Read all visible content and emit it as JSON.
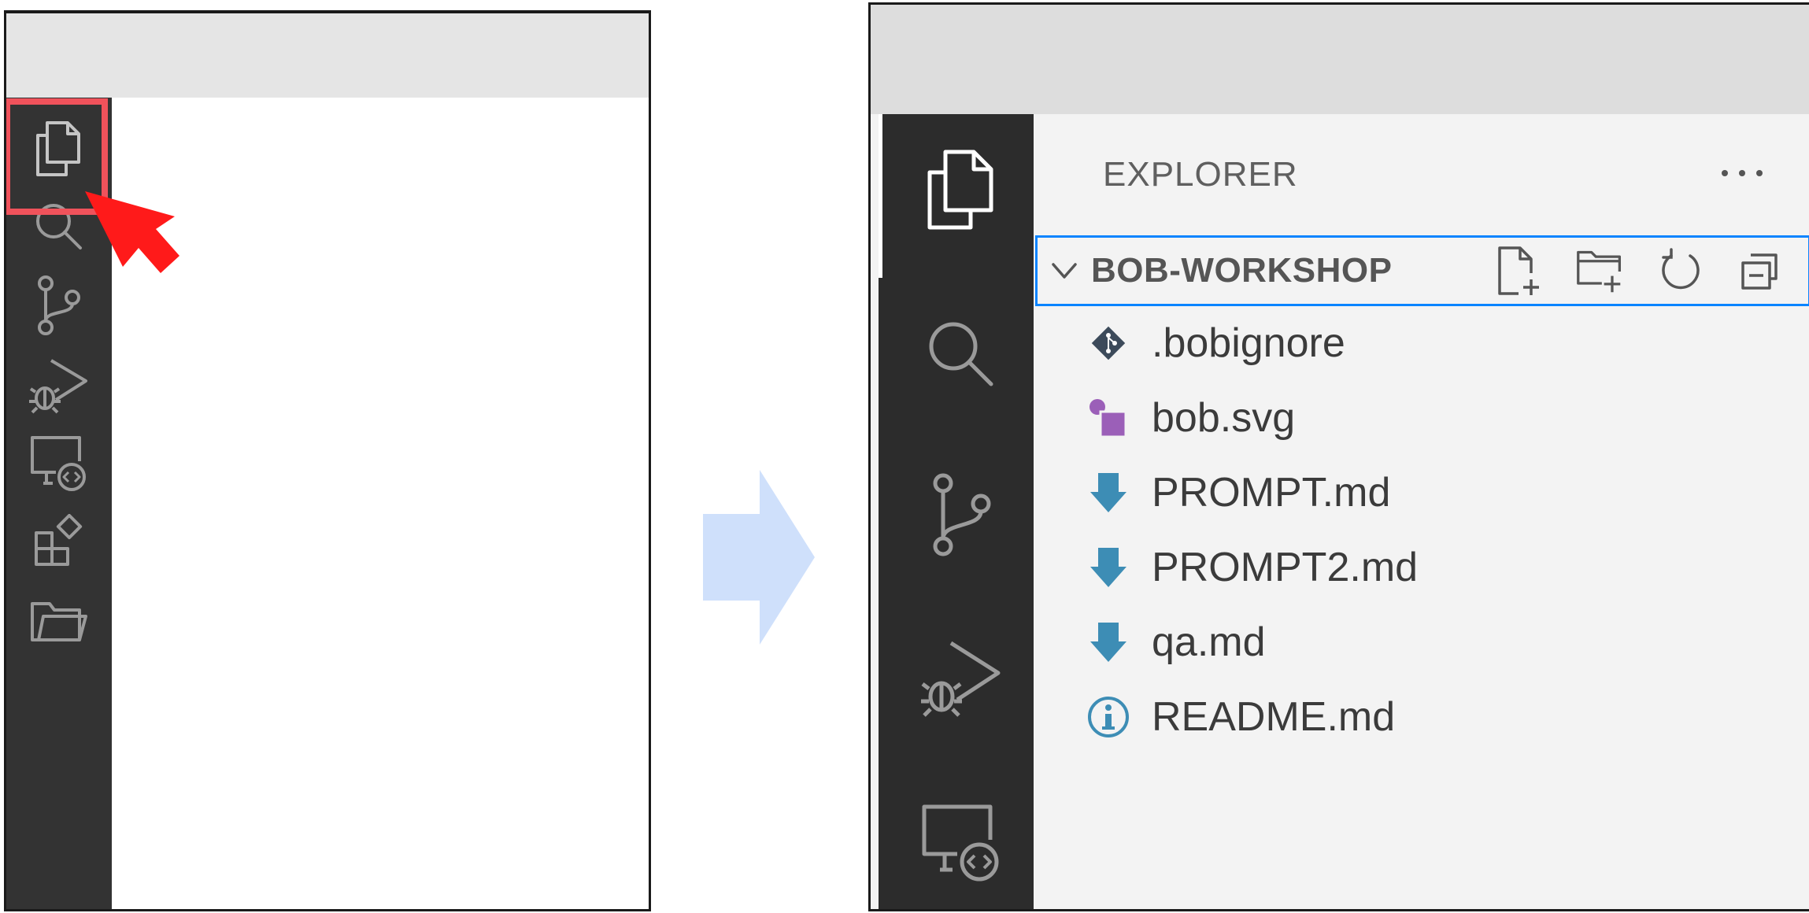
{
  "explorer": {
    "title": "EXPLORER",
    "more_label": "···",
    "folder": {
      "name": "BOB-WORKSHOP",
      "actions": [
        "new-file-icon",
        "new-folder-icon",
        "refresh-icon",
        "collapse-all-icon"
      ]
    },
    "files": [
      {
        "name": ".bobignore",
        "icon": "git-diamond-icon",
        "color": "#3c4a5a"
      },
      {
        "name": "bob.svg",
        "icon": "svg-file-icon",
        "color": "#9b5fb8"
      },
      {
        "name": "PROMPT.md",
        "icon": "markdown-arrow-icon",
        "color": "#3d8db5"
      },
      {
        "name": "PROMPT2.md",
        "icon": "markdown-arrow-icon",
        "color": "#3d8db5"
      },
      {
        "name": "qa.md",
        "icon": "markdown-arrow-icon",
        "color": "#3d8db5"
      },
      {
        "name": "README.md",
        "icon": "info-icon",
        "color": "#3d8db5"
      }
    ]
  },
  "left_activity_icons": [
    "explorer-icon",
    "search-icon",
    "source-control-icon",
    "run-debug-icon",
    "remote-explorer-icon",
    "extensions-icon",
    "folder-icon"
  ],
  "right_activity_icons": [
    "explorer-icon",
    "search-icon",
    "source-control-icon",
    "run-debug-icon",
    "remote-explorer-icon"
  ],
  "colors": {
    "highlight": "#f0525b",
    "pointer": "#ff1a1a",
    "transition_arrow": "#cfe0fb",
    "focus_border": "#0a84ff",
    "activity_bar": "#333333"
  }
}
